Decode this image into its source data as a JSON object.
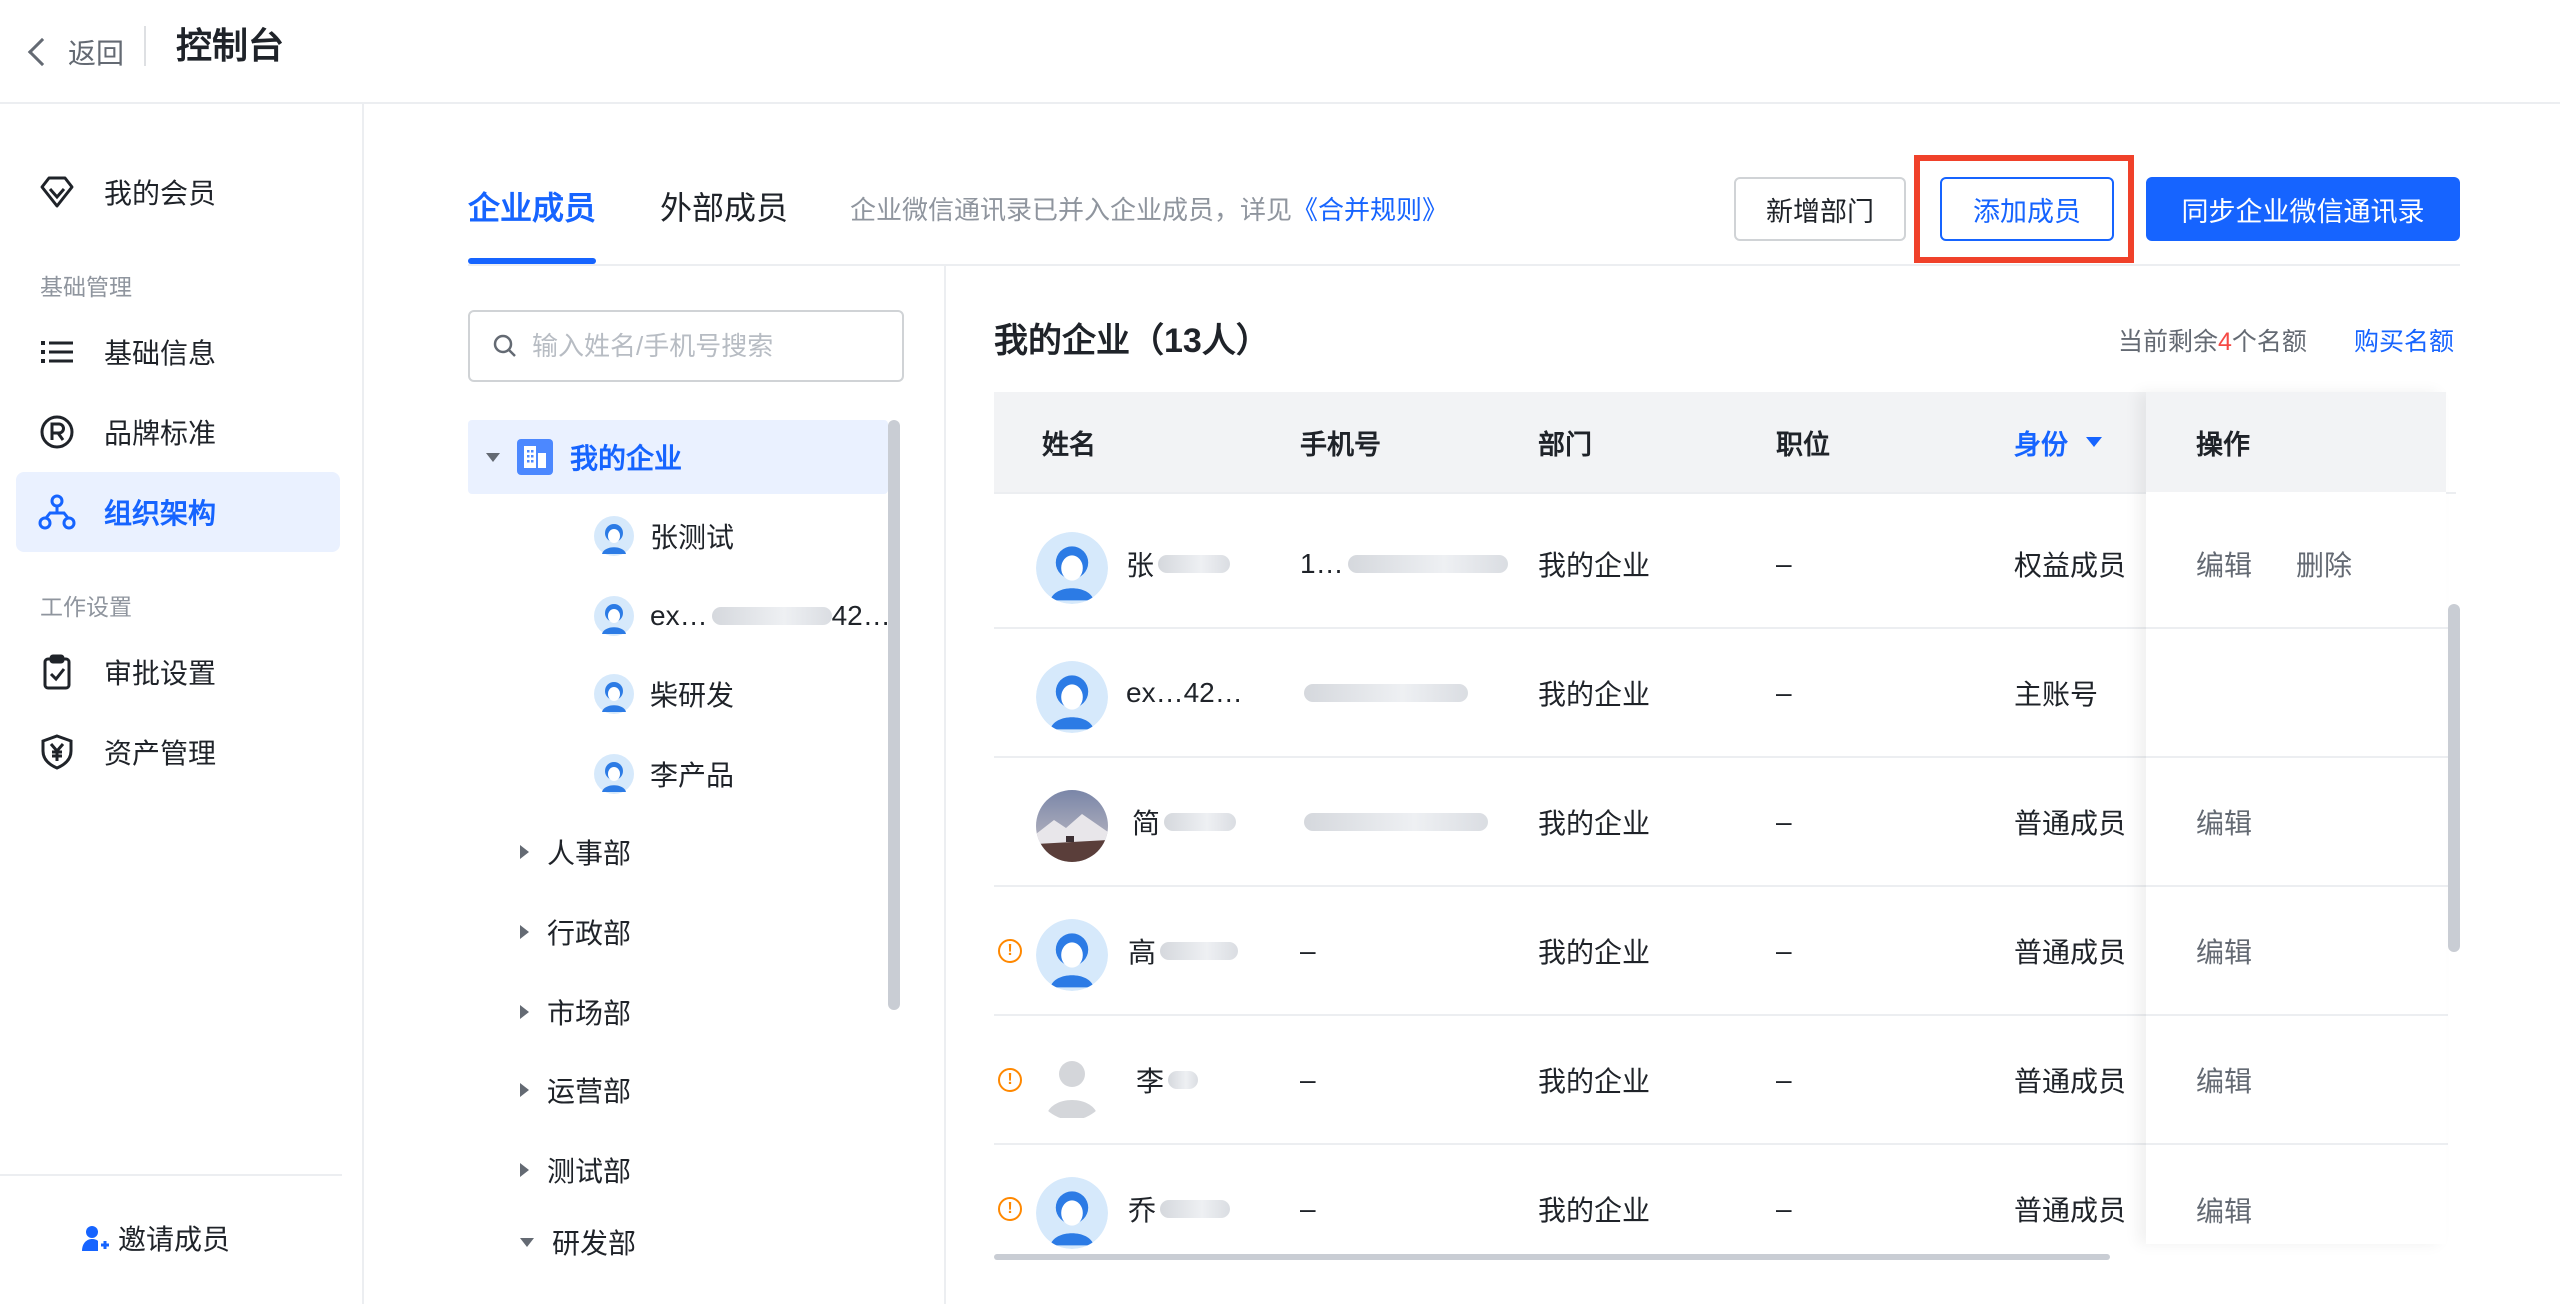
{
  "header": {
    "back_label": "返回",
    "title": "控制台"
  },
  "sidebar": {
    "items": [
      {
        "label": "我的会员",
        "icon": "diamond-icon"
      },
      {
        "label": "基础信息",
        "icon": "list-icon"
      },
      {
        "label": "品牌标准",
        "icon": "registered-icon"
      },
      {
        "label": "组织架构",
        "icon": "org-chart-icon",
        "active": true
      },
      {
        "label": "审批设置",
        "icon": "clipboard-check-icon"
      },
      {
        "label": "资产管理",
        "icon": "yen-shield-icon"
      }
    ],
    "groups": {
      "basic": "基础管理",
      "work": "工作设置"
    },
    "invite_label": "邀请成员"
  },
  "tabs": [
    {
      "label": "企业成员",
      "active": true
    },
    {
      "label": "外部成员",
      "active": false
    }
  ],
  "notice": {
    "text": "企业微信通讯录已并入企业成员，详见",
    "link": "《合并规则》"
  },
  "actions": {
    "add_dept": "新增部门",
    "add_member": "添加成员",
    "sync": "同步企业微信通讯录"
  },
  "tree": {
    "search_placeholder": "输入姓名/手机号搜索",
    "root": "我的企业",
    "members": [
      "张测试",
      "ex…",
      "柴研发",
      "李产品"
    ],
    "member_partial": "42…",
    "departments": [
      "人事部",
      "行政部",
      "市场部",
      "运营部",
      "测试部",
      "研发部"
    ]
  },
  "table": {
    "title": "我的企业（13人）",
    "quota_prefix": "当前剩余",
    "quota_count": "4",
    "quota_suffix": "个名额",
    "buy_label": "购买名额",
    "columns": {
      "name": "姓名",
      "phone": "手机号",
      "dept": "部门",
      "position": "职位",
      "role": "身份",
      "ops": "操作"
    },
    "rows": [
      {
        "name": "张",
        "phone": "1…",
        "dept": "我的企业",
        "position": "–",
        "role": "权益成员",
        "ops": [
          "编辑",
          "删除"
        ],
        "warn": false,
        "avatar": "default"
      },
      {
        "name": "ex…42…",
        "phone": "",
        "dept": "我的企业",
        "position": "–",
        "role": "主账号",
        "ops": [],
        "warn": false,
        "avatar": "default"
      },
      {
        "name": "简",
        "phone": "",
        "dept": "我的企业",
        "position": "–",
        "role": "普通成员",
        "ops": [
          "编辑"
        ],
        "warn": false,
        "avatar": "photo"
      },
      {
        "name": "高",
        "phone": "–",
        "dept": "我的企业",
        "position": "–",
        "role": "普通成员",
        "ops": [
          "编辑"
        ],
        "warn": true,
        "avatar": "default"
      },
      {
        "name": "李",
        "phone": "–",
        "dept": "我的企业",
        "position": "–",
        "role": "普通成员",
        "ops": [
          "编辑"
        ],
        "warn": true,
        "avatar": "gray"
      },
      {
        "name": "乔",
        "phone": "–",
        "dept": "我的企业",
        "position": "–",
        "role": "普通成员",
        "ops": [
          "编辑"
        ],
        "warn": true,
        "avatar": "default"
      }
    ]
  },
  "colors": {
    "primary": "#1664ff",
    "highlight": "#f0412a",
    "warning": "#ff8800",
    "danger": "#f54a45"
  }
}
